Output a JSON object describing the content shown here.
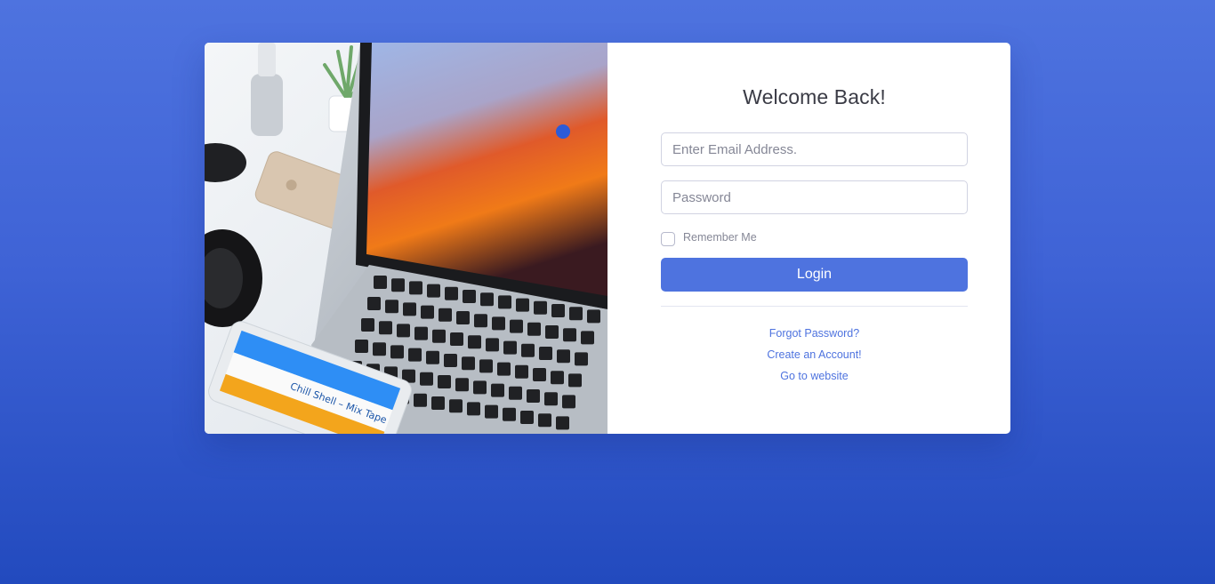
{
  "login": {
    "heading": "Welcome Back!",
    "email_placeholder": "Enter Email Address.",
    "password_placeholder": "Password",
    "remember_label": "Remember Me",
    "login_label": "Login",
    "links": {
      "forgot": "Forgot Password?",
      "create": "Create an Account!",
      "website": "Go to website"
    }
  },
  "image": {
    "cassette_label": "Chill Shell – Mix Tape"
  },
  "colors": {
    "primary": "#4e73df",
    "background_top": "#4e73df",
    "background_bottom": "#224abe",
    "heading": "#3a3b45",
    "muted": "#858796"
  }
}
